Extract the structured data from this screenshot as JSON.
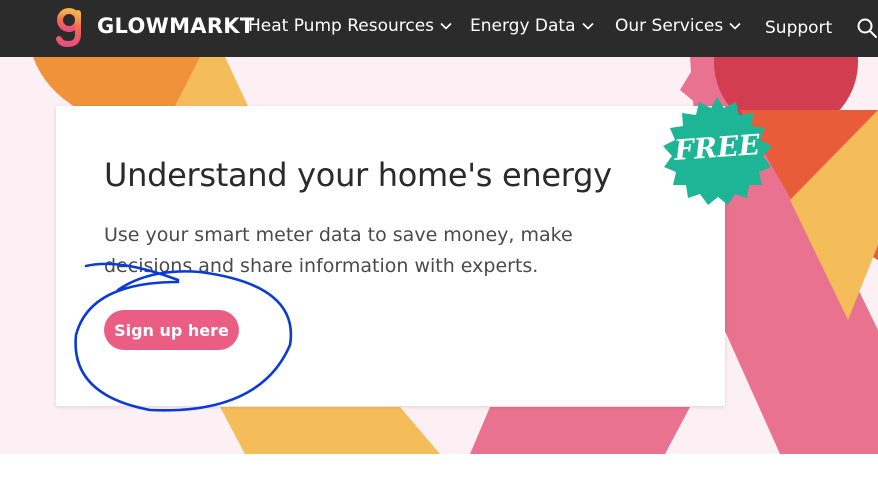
{
  "nav": {
    "brand": "GLOWMARKT",
    "items": [
      {
        "label": "Heat Pump Resources",
        "has_dropdown": true
      },
      {
        "label": "Energy Data",
        "has_dropdown": true
      },
      {
        "label": "Our Services",
        "has_dropdown": true
      },
      {
        "label": "Support",
        "has_dropdown": false
      }
    ]
  },
  "hero": {
    "title": "Understand your home's energy",
    "description": "Use your smart meter data to save money, make decisions and share information with experts.",
    "cta_label": "Sign up here",
    "badge": "FREE"
  },
  "colors": {
    "nav_bg": "#2b2b2b",
    "hero_bg": "#fdf0f4",
    "cta": "#ea5e86",
    "badge": "#1eb597",
    "annotation": "#0a3bd6"
  }
}
